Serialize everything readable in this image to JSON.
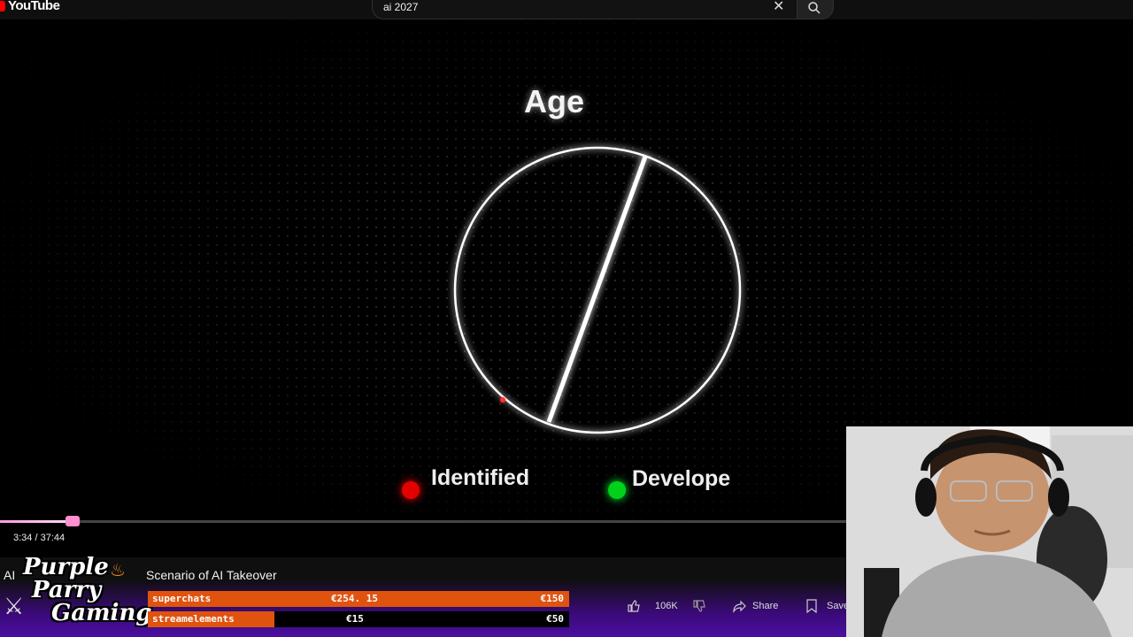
{
  "app": {
    "name": "YouTube"
  },
  "search": {
    "query": "ai 2027"
  },
  "video_frame": {
    "title_text": "Age",
    "legend": [
      {
        "label": "Identified",
        "color": "#e30000"
      },
      {
        "label": "Develope",
        "color": "#00d21a"
      }
    ]
  },
  "player": {
    "time": "3:34 / 37:44",
    "progress_fraction": 0.094
  },
  "video_info": {
    "title_part": "Scenario of AI Takeover",
    "title_prefix": "AI",
    "channel_lines": [
      "Purple",
      "Parry",
      "Gaming"
    ]
  },
  "goals": [
    {
      "name": "superchats",
      "current": "€254. 15",
      "target": "€150",
      "fill_fraction": 1.0,
      "color": "#e0530f"
    },
    {
      "name": "streamelements",
      "current": "€15",
      "target": "€50",
      "fill_fraction": 0.3,
      "color": "#e0530f"
    }
  ],
  "actions": {
    "likes": "106K",
    "share": "Share",
    "save": "Save"
  }
}
